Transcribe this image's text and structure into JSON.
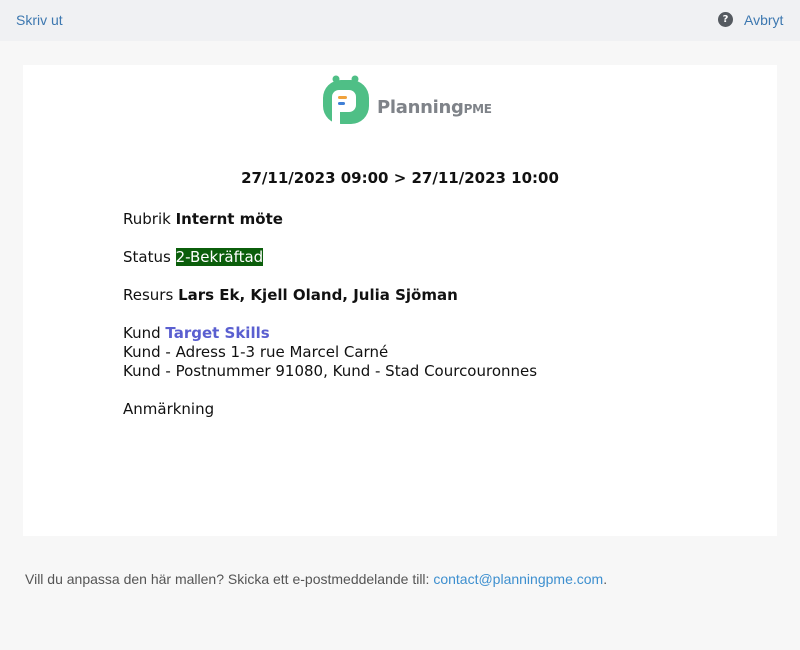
{
  "toolbar": {
    "print_label": "Skriv ut",
    "help_icon": "?",
    "cancel_label": "Avbryt"
  },
  "logo": {
    "name": "Planning",
    "suffix": "PME",
    "colors": {
      "green": "#4fbf86",
      "orange": "#f0a23c",
      "blue": "#3f7fd6"
    }
  },
  "event": {
    "date_range": "27/11/2023 09:00 > 27/11/2023 10:00",
    "rubrik_label": "Rubrik",
    "rubrik_value": "Internt möte",
    "status_label": "Status",
    "status_value": "2-Bekräftad",
    "status_color": "#0b5e0b",
    "resurs_label": "Resurs",
    "resurs_value": "Lars Ek, Kjell Oland, Julia Sjöman",
    "kund_label": "Kund",
    "kund_value": "Target Skills",
    "address_line": "Kund - Adress 1-3 rue Marcel Carné",
    "postal_line": "Kund - Postnummer 91080, Kund - Stad Courcouronnes",
    "note_label": "Anmärkning"
  },
  "footer": {
    "text": "Vill du anpassa den här mallen? Skicka ett e-postmeddelande till: ",
    "email": "contact@planningpme.com",
    "suffix": "."
  }
}
